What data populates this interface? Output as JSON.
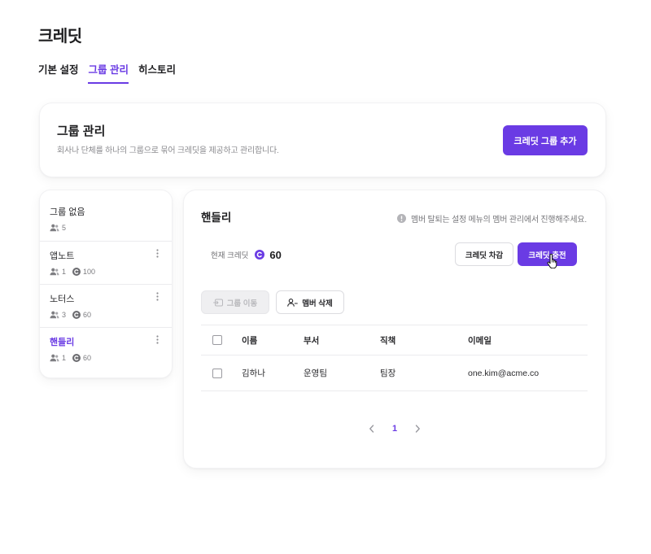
{
  "page": {
    "title": "크레딧"
  },
  "tabs": [
    {
      "label": "기본 설정",
      "active": false
    },
    {
      "label": "그룹 관리",
      "active": true
    },
    {
      "label": "히스토리",
      "active": false
    }
  ],
  "group_header": {
    "title": "그룹 관리",
    "description": "회사나 단체를 하나의 그룹으로 묶어 크레딧을 제공하고 관리합니다.",
    "add_button_label": "크레딧 그룹 추가"
  },
  "groups": [
    {
      "name": "그룹 없음",
      "members": "5",
      "active": false
    },
    {
      "name": "앱노트",
      "members": "1",
      "credits": "100",
      "active": false
    },
    {
      "name": "노터스",
      "members": "3",
      "credits": "60",
      "active": false
    },
    {
      "name": "핸들리",
      "members": "1",
      "credits": "60",
      "active": true
    }
  ],
  "detail": {
    "title": "핸들리",
    "notice": "멤버 탈퇴는 설정 메뉴의 멤버 관리에서 진행해주세요.",
    "credit_label": "현재 크레딧",
    "credit_value": "60",
    "deduct_button_label": "크레딧 차감",
    "charge_button_label": "크레딧 충전",
    "move_button_label": "그룹 이동",
    "move_button_disabled": true,
    "delete_button_label": "멤버 삭제",
    "table": {
      "columns": [
        "이름",
        "부서",
        "직책",
        "이메일"
      ],
      "rows": [
        {
          "name": "김하나",
          "department": "운영팀",
          "position": "팀장",
          "email": "one.kim@acme.co",
          "selected": false
        }
      ]
    },
    "pagination": {
      "current_page": "1"
    }
  },
  "icons": {
    "members": "members-icon",
    "credit": "credit-coin-icon",
    "menu": "kebab-menu-icon",
    "info": "info-icon",
    "move_group": "move-group-icon",
    "delete_member": "user-minus-icon",
    "prev_page": "chevron-left-icon",
    "next_page": "chevron-right-icon",
    "cursor": "hand-cursor-icon"
  },
  "colors": {
    "accent": "#6a3be4",
    "text": "#1e1e20",
    "muted": "#8a8a8e",
    "border": "#ebebee",
    "disabled_bg": "#efeff1",
    "disabled_text": "#b9b9bd"
  }
}
